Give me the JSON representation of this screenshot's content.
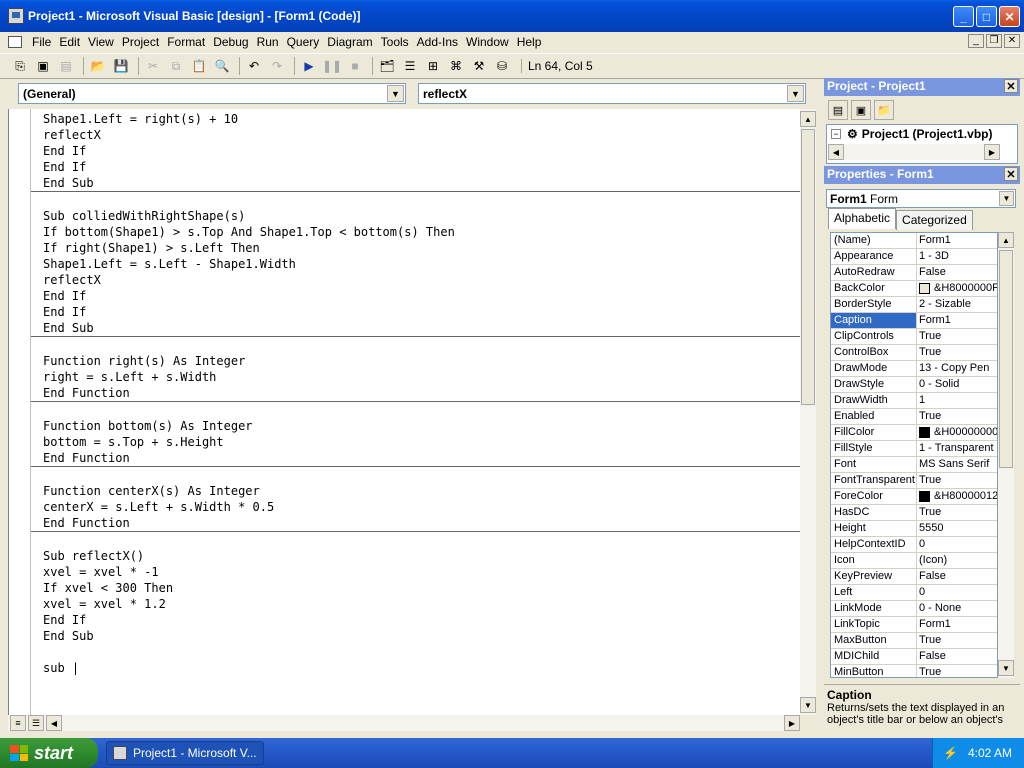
{
  "window": {
    "title": "Project1 - Microsoft Visual Basic [design] - [Form1 (Code)]",
    "minimize": "_",
    "maximize": "□",
    "close": "✕"
  },
  "menu": [
    "File",
    "Edit",
    "View",
    "Project",
    "Format",
    "Debug",
    "Run",
    "Query",
    "Diagram",
    "Tools",
    "Add-Ins",
    "Window",
    "Help"
  ],
  "mdi": {
    "minimize": "_",
    "restore": "❐",
    "close": "✕"
  },
  "toolbar": {
    "status": "Ln 64, Col 5"
  },
  "code": {
    "object_combo": "(General)",
    "proc_combo": "reflectX",
    "lines": [
      "Shape1.Left = right(s) + 10",
      "reflectX",
      "End If",
      "End If",
      "End Sub",
      "---",
      "",
      "Sub colliedWithRightShape(s)",
      "If bottom(Shape1) > s.Top And Shape1.Top < bottom(s) Then",
      "If right(Shape1) > s.Left Then",
      "Shape1.Left = s.Left - Shape1.Width",
      "reflectX",
      "End If",
      "End If",
      "End Sub",
      "---",
      "",
      "Function right(s) As Integer",
      "right = s.Left + s.Width",
      "End Function",
      "---",
      "",
      "Function bottom(s) As Integer",
      "bottom = s.Top + s.Height",
      "End Function",
      "---",
      "",
      "Function centerX(s) As Integer",
      "centerX = s.Left + s.Width * 0.5",
      "End Function",
      "---",
      "",
      "Sub reflectX()",
      "xvel = xvel * -1",
      "If xvel < 300 Then",
      "xvel = xvel * 1.2",
      "End If",
      "End Sub",
      "",
      "sub |"
    ]
  },
  "project": {
    "title": "Project - Project1",
    "tree_item": "Project1 (Project1.vbp)",
    "expander": "−"
  },
  "properties": {
    "title": "Properties - Form1",
    "object_name": "Form1",
    "object_type": "Form",
    "tabs": [
      "Alphabetic",
      "Categorized"
    ],
    "rows": [
      {
        "name": "(Name)",
        "value": "Form1"
      },
      {
        "name": "Appearance",
        "value": "1 - 3D"
      },
      {
        "name": "AutoRedraw",
        "value": "False"
      },
      {
        "name": "BackColor",
        "value": "&H8000000F",
        "swatch": "#ece9d8"
      },
      {
        "name": "BorderStyle",
        "value": "2 - Sizable"
      },
      {
        "name": "Caption",
        "value": "Form1",
        "selected": true
      },
      {
        "name": "ClipControls",
        "value": "True"
      },
      {
        "name": "ControlBox",
        "value": "True"
      },
      {
        "name": "DrawMode",
        "value": "13 - Copy Pen"
      },
      {
        "name": "DrawStyle",
        "value": "0 - Solid"
      },
      {
        "name": "DrawWidth",
        "value": "1"
      },
      {
        "name": "Enabled",
        "value": "True"
      },
      {
        "name": "FillColor",
        "value": "&H00000000",
        "swatch": "#000000"
      },
      {
        "name": "FillStyle",
        "value": "1 - Transparent"
      },
      {
        "name": "Font",
        "value": "MS Sans Serif"
      },
      {
        "name": "FontTransparent",
        "value": "True"
      },
      {
        "name": "ForeColor",
        "value": "&H80000012",
        "swatch": "#000000"
      },
      {
        "name": "HasDC",
        "value": "True"
      },
      {
        "name": "Height",
        "value": "5550"
      },
      {
        "name": "HelpContextID",
        "value": "0"
      },
      {
        "name": "Icon",
        "value": "(Icon)"
      },
      {
        "name": "KeyPreview",
        "value": "False"
      },
      {
        "name": "Left",
        "value": "0"
      },
      {
        "name": "LinkMode",
        "value": "0 - None"
      },
      {
        "name": "LinkTopic",
        "value": "Form1"
      },
      {
        "name": "MaxButton",
        "value": "True"
      },
      {
        "name": "MDIChild",
        "value": "False"
      },
      {
        "name": "MinButton",
        "value": "True"
      }
    ],
    "desc_title": "Caption",
    "desc_text": "Returns/sets the text displayed in an object's title bar or below an object's"
  },
  "taskbar": {
    "start": "start",
    "task": "Project1 - Microsoft V...",
    "clock": "4:02 AM"
  }
}
